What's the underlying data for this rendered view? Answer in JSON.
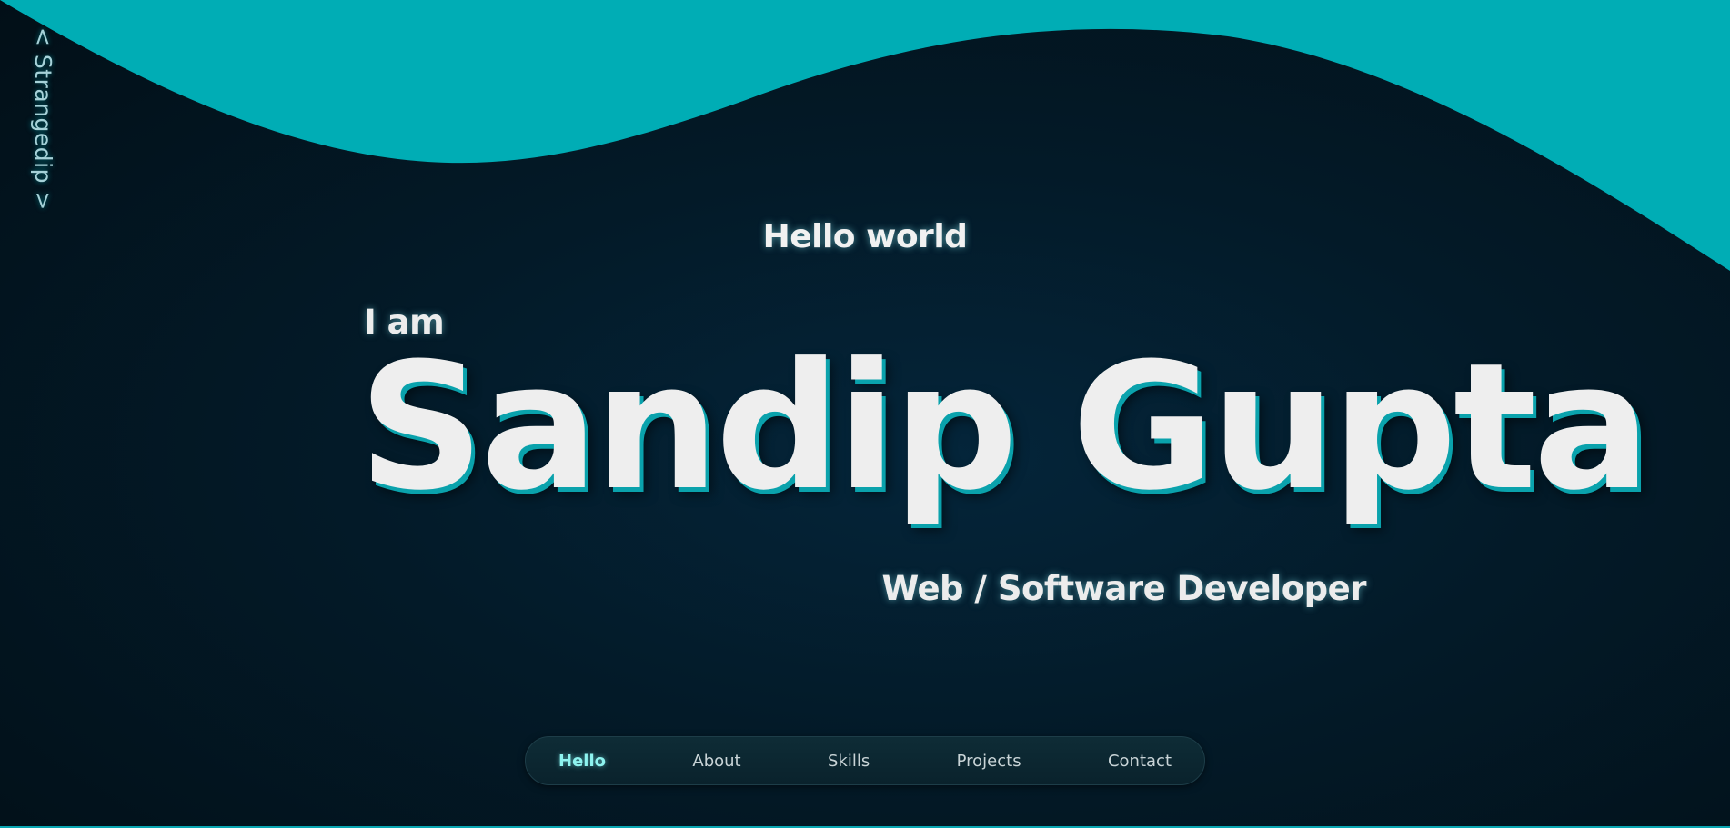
{
  "brand": {
    "label": "< Strangedip >"
  },
  "hero": {
    "greeting": "Hello world",
    "intro": "I am",
    "name": "Sandip Gupta",
    "role": "Web / Software Developer"
  },
  "nav": {
    "items": [
      {
        "label": "Hello",
        "active": true
      },
      {
        "label": "About",
        "active": false
      },
      {
        "label": "Skills",
        "active": false
      },
      {
        "label": "Projects",
        "active": false
      },
      {
        "label": "Contact",
        "active": false
      }
    ]
  },
  "colors": {
    "background": "#03141e",
    "wave": "#00adb5",
    "text": "#eeeeee",
    "accent": "#0aa2ac",
    "nav_active": "#8ef3ef"
  }
}
